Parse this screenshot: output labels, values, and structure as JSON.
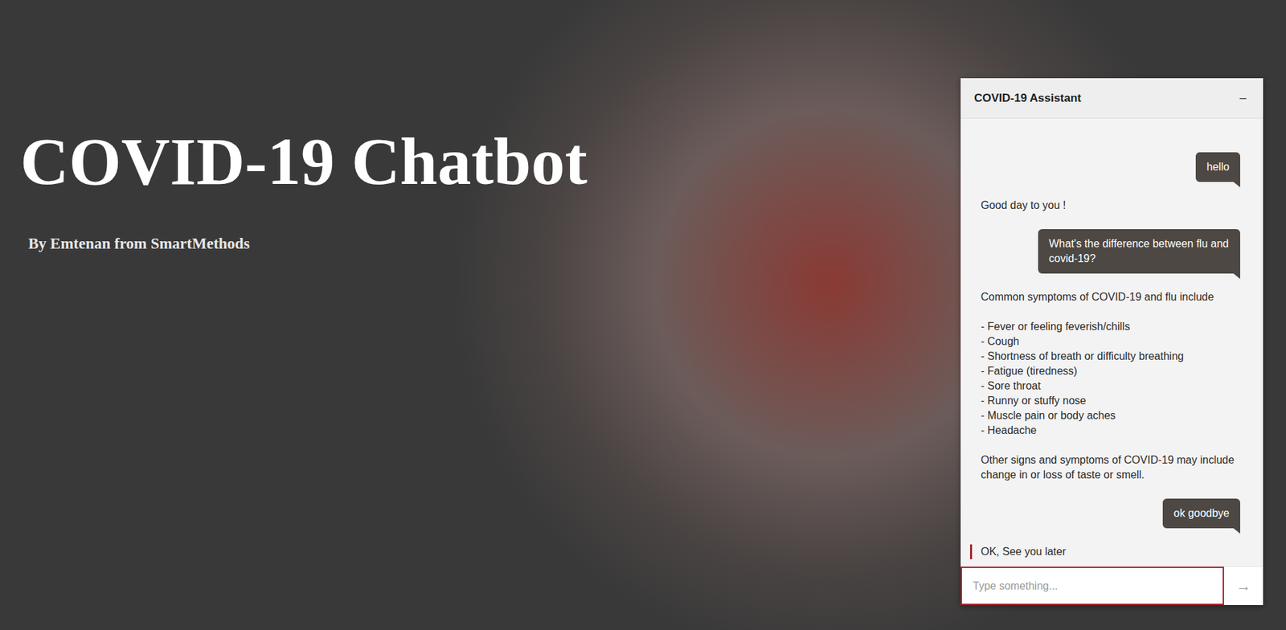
{
  "page": {
    "title": "COVID-19 Chatbot",
    "subtitle": "By Emtenan from SmartMethods"
  },
  "chat": {
    "title": "COVID-19 Assistant",
    "minimize": "−",
    "messages": [
      {
        "kind": "user",
        "text": "hello",
        "highlighted": false
      },
      {
        "kind": "bot",
        "text": "Good day to you !",
        "highlighted": false
      },
      {
        "kind": "user",
        "text": "What's the difference between flu and covid-19?",
        "highlighted": false
      },
      {
        "kind": "bot",
        "text": "Common symptoms of COVID-19 and flu include\n\n- Fever or feeling feverish/chills\n- Cough\n- Shortness of breath or difficulty breathing\n- Fatigue (tiredness)\n- Sore throat\n- Runny or stuffy nose\n- Muscle pain or body aches\n- Headache\n\nOther signs and symptoms of COVID-19 may include change in or loss of taste or smell.",
        "highlighted": false
      },
      {
        "kind": "user",
        "text": "ok goodbye",
        "highlighted": false
      },
      {
        "kind": "bot",
        "text": "OK, See you later",
        "highlighted": true
      }
    ],
    "input": {
      "placeholder": "Type something..."
    },
    "send": "→"
  }
}
